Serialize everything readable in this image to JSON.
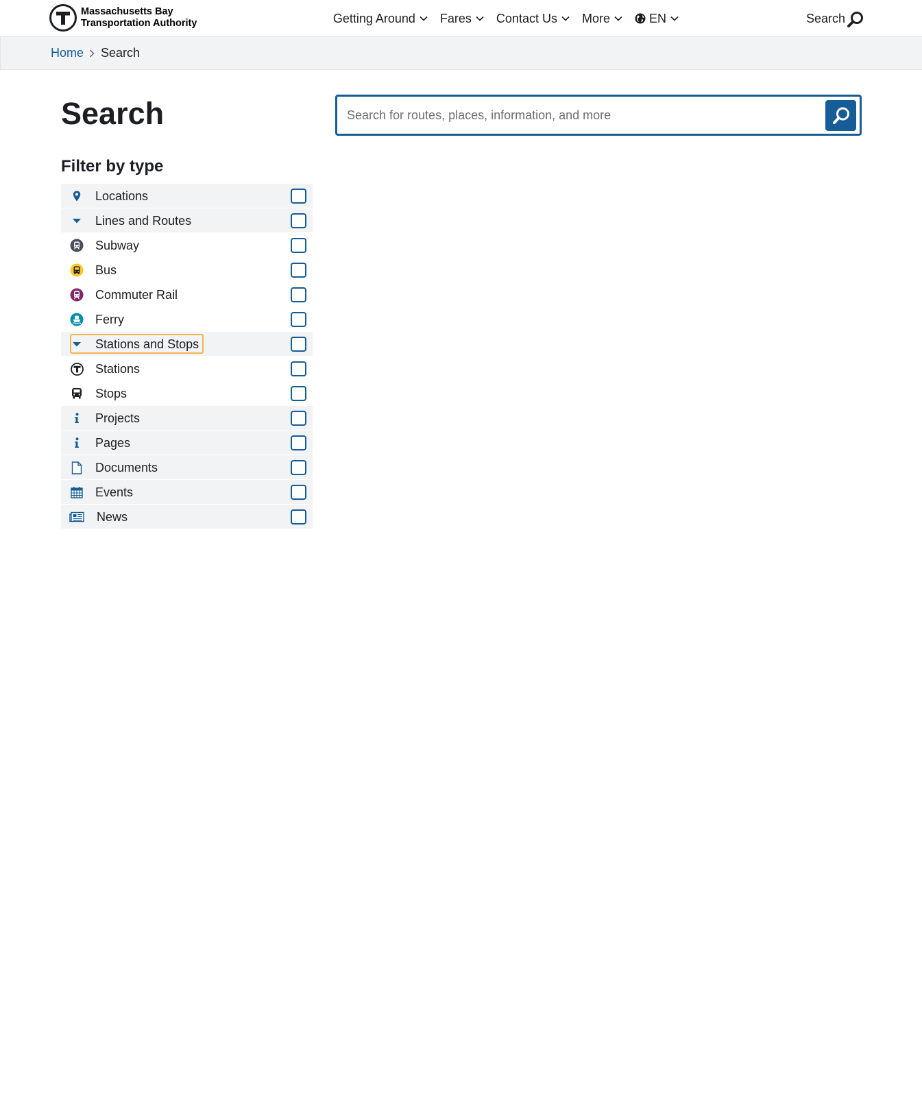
{
  "header": {
    "logo_line1": "Massachusetts Bay",
    "logo_line2": "Transportation Authority",
    "nav": [
      {
        "label": "Getting Around"
      },
      {
        "label": "Fares"
      },
      {
        "label": "Contact Us"
      },
      {
        "label": "More"
      },
      {
        "label": "EN"
      }
    ],
    "search_label": "Search"
  },
  "breadcrumb": {
    "home": "Home",
    "current": "Search"
  },
  "page": {
    "title": "Search"
  },
  "search": {
    "placeholder": "Search for routes, places, information, and more",
    "value": ""
  },
  "filter": {
    "title": "Filter by type",
    "items": [
      {
        "label": "Locations",
        "icon": "map-pin-icon",
        "checked": false
      },
      {
        "label": "Lines and Routes",
        "icon": "caret-down-icon",
        "checked": false
      },
      {
        "label": "Subway",
        "icon": "subway-icon",
        "checked": false
      },
      {
        "label": "Bus",
        "icon": "bus-icon",
        "checked": false
      },
      {
        "label": "Commuter Rail",
        "icon": "commuter-rail-icon",
        "checked": false
      },
      {
        "label": "Ferry",
        "icon": "ferry-icon",
        "checked": false
      },
      {
        "label": "Stations and Stops",
        "icon": "caret-down-icon",
        "checked": false
      },
      {
        "label": "Stations",
        "icon": "t-logo-icon",
        "checked": false
      },
      {
        "label": "Stops",
        "icon": "bus-stop-icon",
        "checked": false
      },
      {
        "label": "Projects",
        "icon": "info-icon",
        "checked": false
      },
      {
        "label": "Pages",
        "icon": "info-icon",
        "checked": false
      },
      {
        "label": "Documents",
        "icon": "document-icon",
        "checked": false
      },
      {
        "label": "Events",
        "icon": "calendar-icon",
        "checked": false
      },
      {
        "label": "News",
        "icon": "newspaper-icon",
        "checked": false
      }
    ]
  },
  "colors": {
    "brand_blue": "#165c96",
    "text": "#1c1e23",
    "row_shade": "#f2f3f5",
    "focus_ring": "#f3b54a",
    "bus_yellow": "#ffc72c",
    "commuter_purple": "#80276c",
    "ferry_teal": "#008eaa",
    "subway_gray": "#494f5c"
  }
}
